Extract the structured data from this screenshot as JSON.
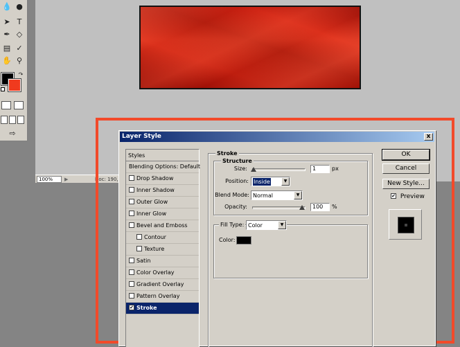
{
  "app": {
    "status_zoom": "100%",
    "status_info": "Doc: 190,"
  },
  "colors": {
    "foreground": "#000000",
    "background": "#f03a1e",
    "highlight_frame": "#f24a2a",
    "titlebar": "#0a246a"
  },
  "dialog": {
    "title": "Layer Style",
    "close_label": "x",
    "styles_header": "Styles",
    "styles": [
      {
        "label": "Blending Options: Default",
        "checkbox": false,
        "checked": false,
        "indent": false,
        "selected": false
      },
      {
        "label": "Drop Shadow",
        "checkbox": true,
        "checked": false,
        "indent": false,
        "selected": false
      },
      {
        "label": "Inner Shadow",
        "checkbox": true,
        "checked": false,
        "indent": false,
        "selected": false
      },
      {
        "label": "Outer Glow",
        "checkbox": true,
        "checked": false,
        "indent": false,
        "selected": false
      },
      {
        "label": "Inner Glow",
        "checkbox": true,
        "checked": false,
        "indent": false,
        "selected": false
      },
      {
        "label": "Bevel and Emboss",
        "checkbox": true,
        "checked": false,
        "indent": false,
        "selected": false
      },
      {
        "label": "Contour",
        "checkbox": true,
        "checked": false,
        "indent": true,
        "selected": false
      },
      {
        "label": "Texture",
        "checkbox": true,
        "checked": false,
        "indent": true,
        "selected": false
      },
      {
        "label": "Satin",
        "checkbox": true,
        "checked": false,
        "indent": false,
        "selected": false
      },
      {
        "label": "Color Overlay",
        "checkbox": true,
        "checked": false,
        "indent": false,
        "selected": false
      },
      {
        "label": "Gradient Overlay",
        "checkbox": true,
        "checked": false,
        "indent": false,
        "selected": false
      },
      {
        "label": "Pattern Overlay",
        "checkbox": true,
        "checked": false,
        "indent": false,
        "selected": false
      },
      {
        "label": "Stroke",
        "checkbox": true,
        "checked": true,
        "indent": false,
        "selected": true
      }
    ],
    "stroke": {
      "group_title": "Stroke",
      "structure_title": "Structure",
      "size_label": "Size:",
      "size_value": "1",
      "size_unit": "px",
      "size_fraction": 0.01,
      "position_label": "Position:",
      "position_value": "Inside",
      "blend_label": "Blend Mode:",
      "blend_value": "Normal",
      "opacity_label": "Opacity:",
      "opacity_value": "100",
      "opacity_unit": "%",
      "opacity_fraction": 1.0,
      "fill_type_label": "Fill Type:",
      "fill_type_value": "Color",
      "color_label": "Color:",
      "stroke_color": "#000000"
    },
    "buttons": {
      "ok": "OK",
      "cancel": "Cancel",
      "new_style": "New Style..."
    },
    "preview_label": "Preview",
    "preview_checked": true
  }
}
